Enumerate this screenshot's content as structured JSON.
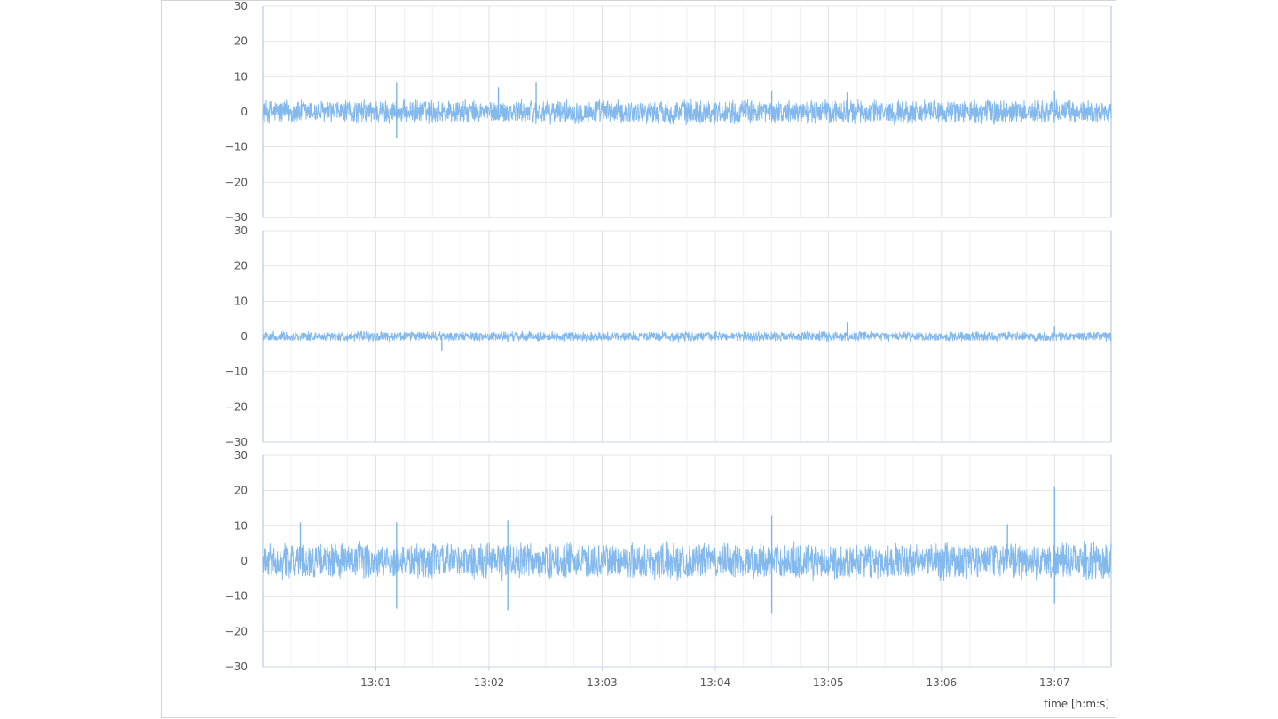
{
  "chart_data": {
    "type": "line",
    "x_axis": {
      "label": "time [h:m:s]",
      "unit": "minutes",
      "range": [
        "13:00:00",
        "13:07:30"
      ],
      "tick_labels": [
        "13:01",
        "13:02",
        "13:03",
        "13:04",
        "13:05",
        "13:06",
        "13:07"
      ]
    },
    "y_axis": {
      "ylim": [
        -30,
        30
      ],
      "tick_labels": [
        "30",
        "20",
        "10",
        "0",
        "−10",
        "−20",
        "−30"
      ]
    },
    "grid": true,
    "line_color": "#7cb5ec",
    "panels": [
      {
        "amplitude_typical": 3.0,
        "spikes": [
          {
            "t": "13:01:11",
            "value": 8.5
          },
          {
            "t": "13:01:11",
            "value": -7.5
          },
          {
            "t": "13:02:05",
            "value": 7.0
          },
          {
            "t": "13:02:25",
            "value": 8.5
          },
          {
            "t": "13:04:30",
            "value": 6.0
          },
          {
            "t": "13:05:10",
            "value": 5.5
          },
          {
            "t": "13:07:00",
            "value": 6.0
          }
        ]
      },
      {
        "amplitude_typical": 1.2,
        "spikes": [
          {
            "t": "13:01:35",
            "value": -4.0
          },
          {
            "t": "13:05:10",
            "value": 4.0
          },
          {
            "t": "13:07:00",
            "value": 3.0
          }
        ]
      },
      {
        "amplitude_typical": 4.5,
        "spikes": [
          {
            "t": "13:00:20",
            "value": 11.0
          },
          {
            "t": "13:01:11",
            "value": 11.0
          },
          {
            "t": "13:01:11",
            "value": -13.5
          },
          {
            "t": "13:02:10",
            "value": 11.5
          },
          {
            "t": "13:02:10",
            "value": -14.0
          },
          {
            "t": "13:04:30",
            "value": 13.0
          },
          {
            "t": "13:04:30",
            "value": -15.0
          },
          {
            "t": "13:06:35",
            "value": 10.5
          },
          {
            "t": "13:07:00",
            "value": 21.0
          },
          {
            "t": "13:07:00",
            "value": -12.0
          }
        ]
      }
    ]
  }
}
